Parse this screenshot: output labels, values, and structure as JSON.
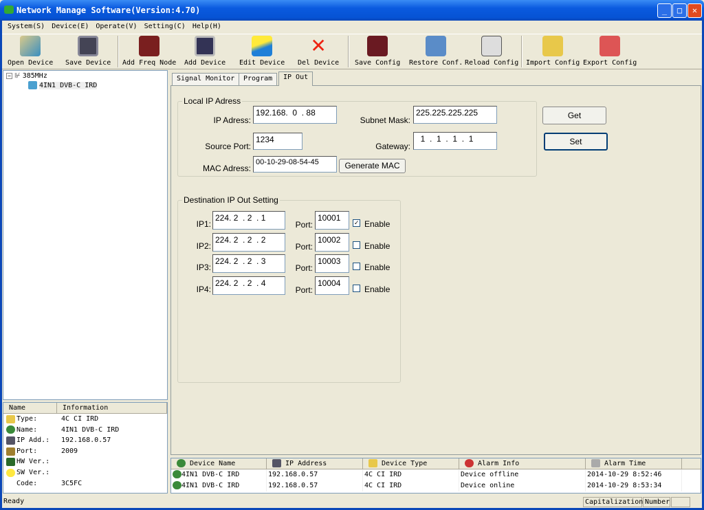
{
  "window": {
    "title": "Network Manage Software(Version:4.70)",
    "minimize": "_",
    "maximize": "□",
    "close": "✕"
  },
  "menu": [
    "System(S)",
    "Device(E)",
    "Operate(V)",
    "Setting(C)",
    "Help(H)"
  ],
  "toolbar": [
    "Open Device",
    "Save Device",
    "Add Freq Node",
    "Add Device",
    "Edit Device",
    "Del Device",
    "Save Config",
    "Restore Conf.",
    "Reload Config",
    "Import Config",
    "Export Config"
  ],
  "tree": {
    "root": "385MHz",
    "child": "4IN1 DVB-C IRD"
  },
  "info": {
    "headers": [
      "Name",
      "Information"
    ],
    "rows": [
      {
        "k": "Type:",
        "v": "4C CI IRD"
      },
      {
        "k": "Name:",
        "v": "4IN1 DVB-C IRD"
      },
      {
        "k": "IP Add.:",
        "v": "192.168.0.57"
      },
      {
        "k": "Port:",
        "v": "2009"
      },
      {
        "k": "HW Ver.:",
        "v": ""
      },
      {
        "k": "SW Ver.:",
        "v": ""
      },
      {
        "k": "Code:",
        "v": "3C5FC"
      }
    ]
  },
  "tabs": [
    "Signal Monitor",
    "Program",
    "IP Out"
  ],
  "local": {
    "title": "Local IP Adress",
    "ip_label": "IP Adress:",
    "ip": "192.168.  0  . 88",
    "mask_label": "Subnet Mask:",
    "mask": "225.225.225.225",
    "port_label": "Source Port:",
    "port": "1234",
    "gw_label": "Gateway:",
    "gw": "  1  .  1  .  1  .  1",
    "mac_label": "MAC Adress:",
    "mac": "00-10-29-08-54-45",
    "gen_mac": "Generate MAC"
  },
  "buttons": {
    "get": "Get",
    "set": "Set"
  },
  "dest": {
    "title": "Destination IP Out Setting",
    "port_label": "Port:",
    "enable_label": "Enable",
    "rows": [
      {
        "label": "IP1:",
        "ip": "224. 2  . 2  . 1",
        "port": "10001",
        "enabled": true
      },
      {
        "label": "IP2:",
        "ip": "224. 2  . 2  . 2",
        "port": "10002",
        "enabled": false
      },
      {
        "label": "IP3:",
        "ip": "224. 2  . 2  . 3",
        "port": "10003",
        "enabled": false
      },
      {
        "label": "IP4:",
        "ip": "224. 2  . 2  . 4",
        "port": "10004",
        "enabled": false
      }
    ]
  },
  "alarm": {
    "headers": [
      "Device Name",
      "IP Address",
      "Device Type",
      "Alarm Info",
      "Alarm Time"
    ],
    "rows": [
      [
        "4IN1 DVB-C IRD",
        "192.168.0.57",
        "4C CI IRD",
        "Device offline",
        "2014-10-29 8:52:46"
      ],
      [
        "4IN1 DVB-C IRD",
        "192.168.0.57",
        "4C CI IRD",
        "Device online",
        "2014-10-29 8:53:34"
      ]
    ]
  },
  "status": {
    "text": "Ready",
    "caps": "Capitalization",
    "num": "Number"
  }
}
